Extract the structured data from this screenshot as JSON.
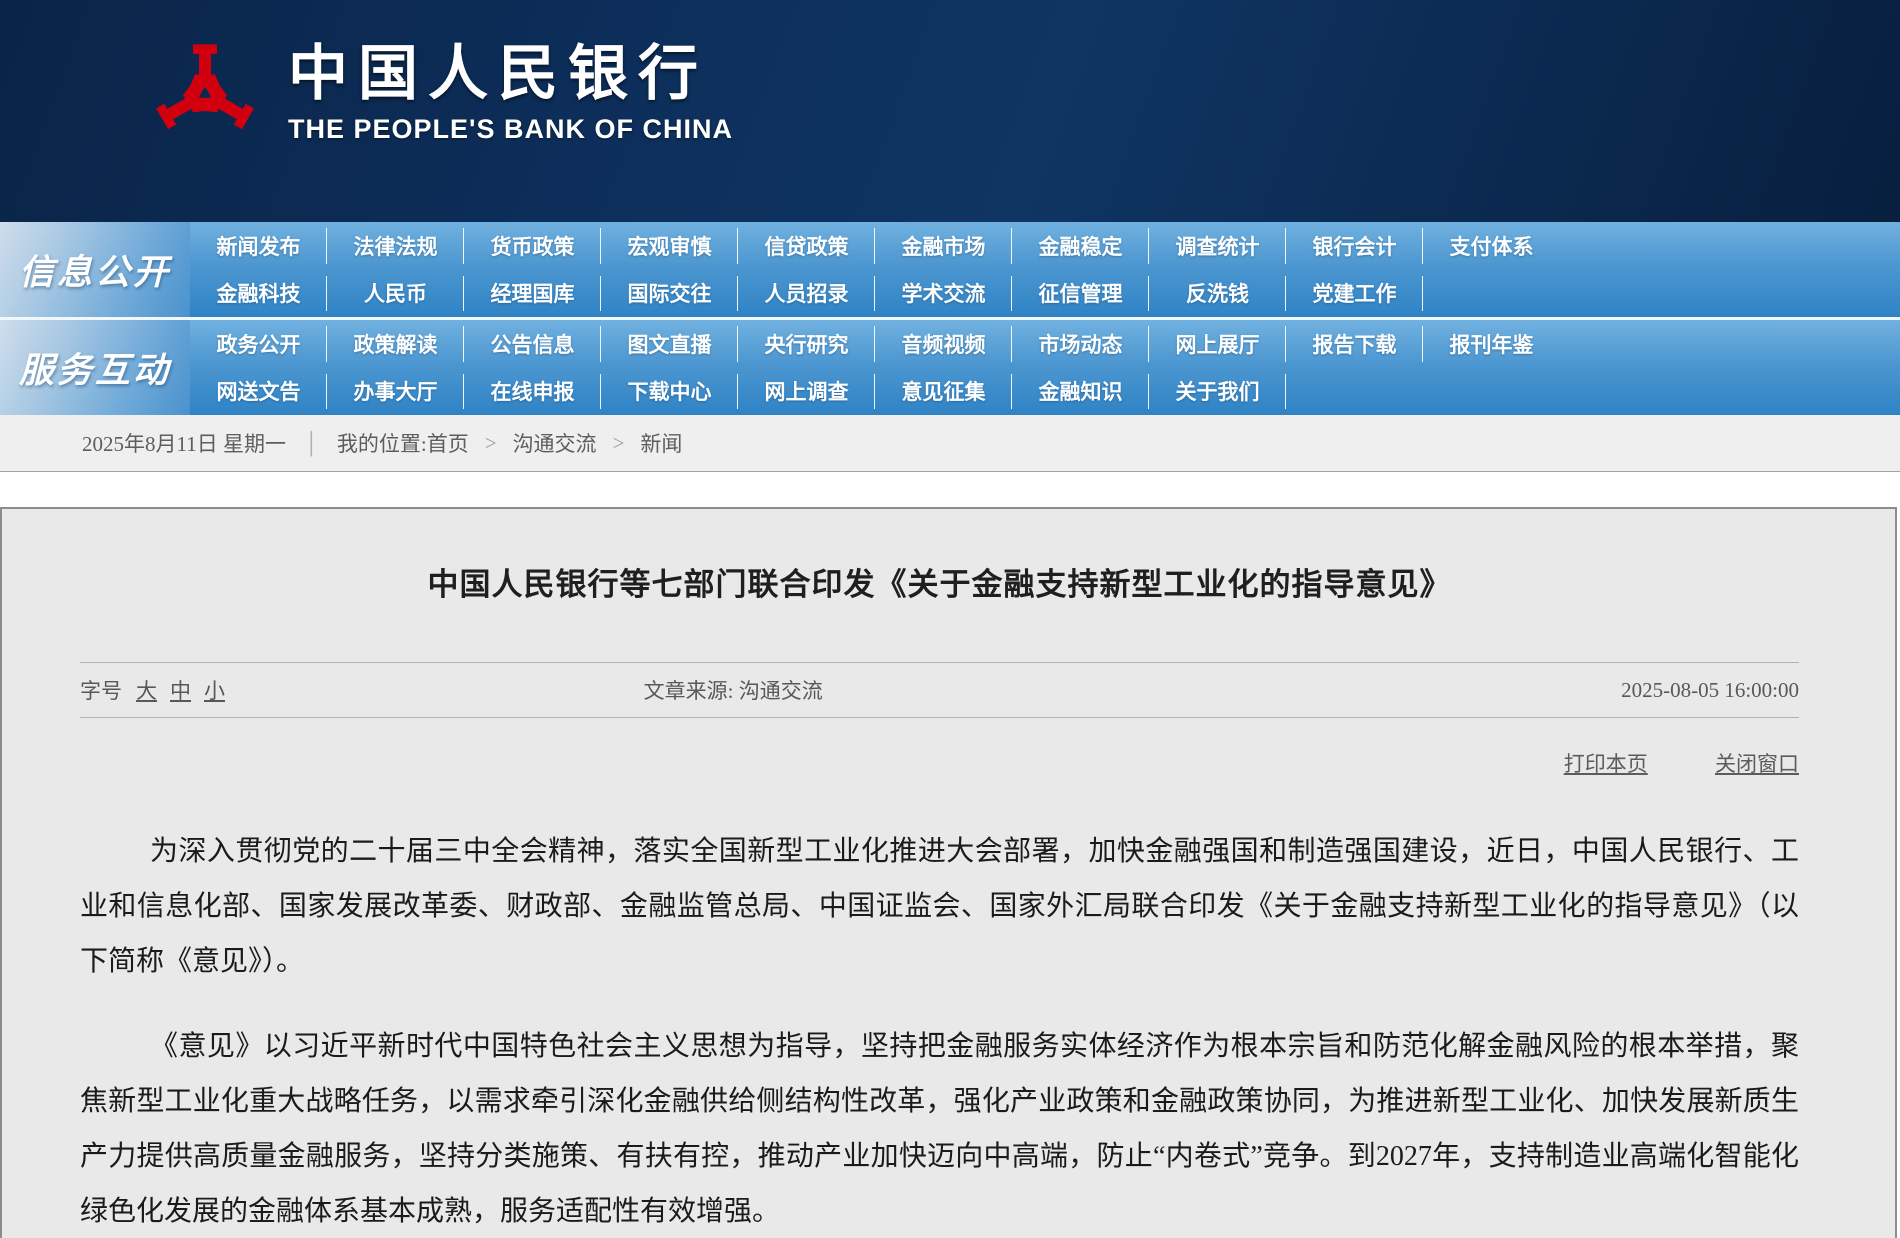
{
  "colors": {
    "accent_red": "#d2000f",
    "nav_blue": "#2f83c5",
    "header_navy": "#0d2f5c",
    "article_bg": "#e9e9ea"
  },
  "header": {
    "site_name_cn": "中国人民银行",
    "site_name_en": "THE PEOPLE'S BANK OF CHINA"
  },
  "nav": {
    "sections": [
      {
        "label": "信息公开",
        "rows": [
          [
            "新闻发布",
            "法律法规",
            "货币政策",
            "宏观审慎",
            "信贷政策",
            "金融市场",
            "金融稳定",
            "调查统计",
            "银行会计",
            "支付体系"
          ],
          [
            "金融科技",
            "人民币",
            "经理国库",
            "国际交往",
            "人员招录",
            "学术交流",
            "征信管理",
            "反洗钱",
            "党建工作"
          ]
        ]
      },
      {
        "label": "服务互动",
        "rows": [
          [
            "政务公开",
            "政策解读",
            "公告信息",
            "图文直播",
            "央行研究",
            "音频视频",
            "市场动态",
            "网上展厅",
            "报告下载",
            "报刊年鉴"
          ],
          [
            "网送文告",
            "办事大厅",
            "在线申报",
            "下载中心",
            "网上调查",
            "意见征集",
            "金融知识",
            "关于我们"
          ]
        ]
      }
    ]
  },
  "breadcrumb": {
    "date": "2025年8月11日 星期一",
    "divider": "│",
    "location_prefix": "我的位置:",
    "crumbs": [
      "首页",
      "沟通交流",
      "新闻"
    ],
    "separator": ">"
  },
  "article": {
    "title": "中国人民银行等七部门联合印发《关于金融支持新型工业化的指导意见》",
    "meta": {
      "font_size_label": "字号",
      "size_large": "大",
      "size_medium": "中",
      "size_small": "小",
      "source_label": "文章来源:",
      "source": "沟通交流",
      "datetime": "2025-08-05 16:00:00"
    },
    "actions": {
      "print": "打印本页",
      "close": "关闭窗口"
    },
    "paragraphs": [
      "为深入贯彻党的二十届三中全会精神，落实全国新型工业化推进大会部署，加快金融强国和制造强国建设，近日，中国人民银行、工业和信息化部、国家发展改革委、财政部、金融监管总局、中国证监会、国家外汇局联合印发《关于金融支持新型工业化的指导意见》（以下简称《意见》）。",
      "《意见》以习近平新时代中国特色社会主义思想为指导，坚持把金融服务实体经济作为根本宗旨和防范化解金融风险的根本举措，聚焦新型工业化重大战略任务，以需求牵引深化金融供给侧结构性改革，强化产业政策和金融政策协同，为推进新型工业化、加快发展新质生产力提供高质量金融服务，坚持分类施策、有扶有控，推动产业加快迈向中高端，防止“内卷式”竞争。到2027年，支持制造业高端化智能化绿色化发展的金融体系基本成熟，服务适配性有效增强。"
    ]
  }
}
